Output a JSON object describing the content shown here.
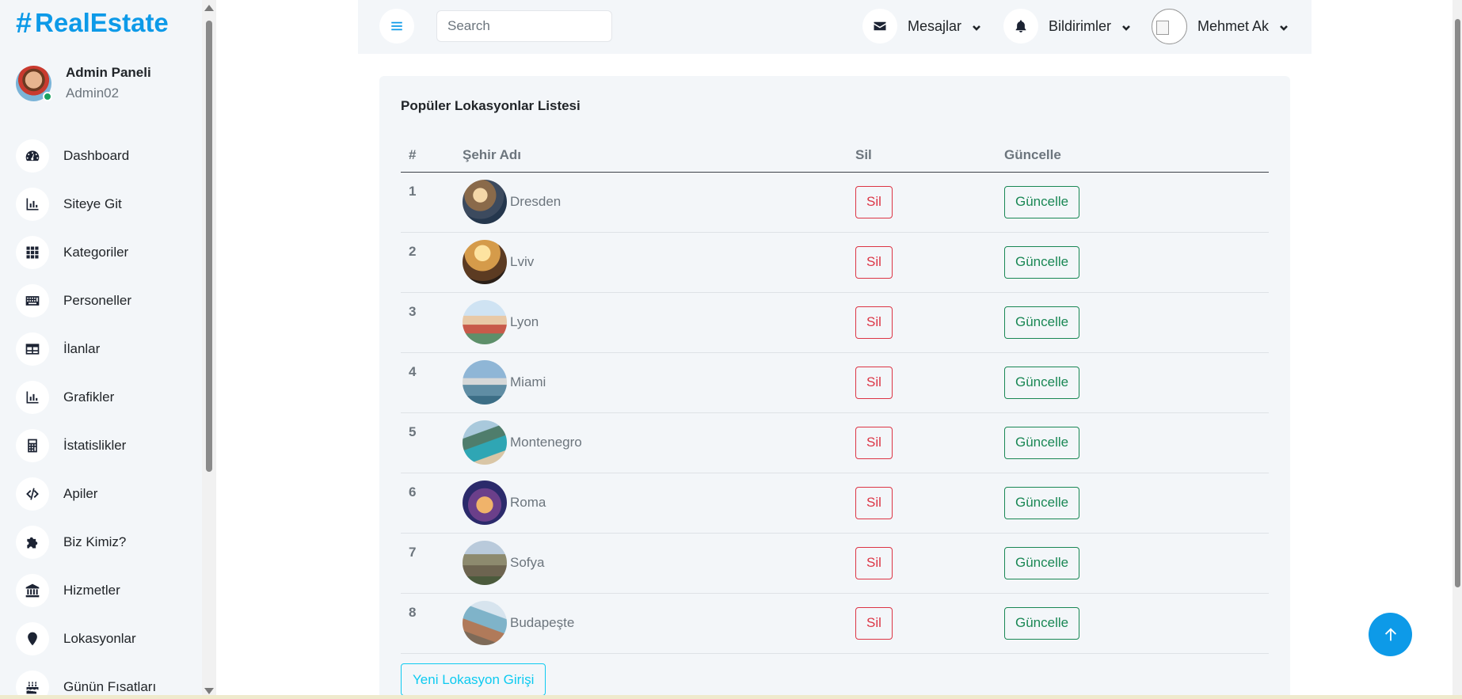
{
  "brand": {
    "hash": "#",
    "name": "RealEstate"
  },
  "profile": {
    "title": "Admin Paneli",
    "role": "Admin02"
  },
  "sidebar": {
    "items": [
      {
        "label": "Dashboard",
        "icon": "tachometer-icon"
      },
      {
        "label": "Siteye Git",
        "icon": "bar-chart-icon"
      },
      {
        "label": "Kategoriler",
        "icon": "grid-icon"
      },
      {
        "label": "Personeller",
        "icon": "keyboard-icon"
      },
      {
        "label": "İlanlar",
        "icon": "table-icon"
      },
      {
        "label": "Grafikler",
        "icon": "bar-chart-icon"
      },
      {
        "label": "İstatislikler",
        "icon": "calculator-icon"
      },
      {
        "label": "Apiler",
        "icon": "code-icon"
      },
      {
        "label": "Biz Kimiz?",
        "icon": "puzzle-icon"
      },
      {
        "label": "Hizmetler",
        "icon": "bank-icon"
      },
      {
        "label": "Lokasyonlar",
        "icon": "map-marker-icon"
      },
      {
        "label": "Günün Fısatları",
        "icon": "birthday-cake-icon"
      }
    ]
  },
  "topbar": {
    "search_placeholder": "Search",
    "messages_label": "Mesajlar",
    "notifications_label": "Bildirimler",
    "user_name": "Mehmet Ak"
  },
  "card": {
    "title": "Popüler Lokasyonlar Listesi",
    "columns": [
      "#",
      "Şehir Adı",
      "Sil",
      "Güncelle"
    ],
    "rows": [
      {
        "num": "1",
        "city": "Dresden",
        "delete": "Sil",
        "update": "Güncelle"
      },
      {
        "num": "2",
        "city": "Lviv",
        "delete": "Sil",
        "update": "Güncelle"
      },
      {
        "num": "3",
        "city": "Lyon",
        "delete": "Sil",
        "update": "Güncelle"
      },
      {
        "num": "4",
        "city": "Miami",
        "delete": "Sil",
        "update": "Güncelle"
      },
      {
        "num": "5",
        "city": "Montenegro",
        "delete": "Sil",
        "update": "Güncelle"
      },
      {
        "num": "6",
        "city": "Roma",
        "delete": "Sil",
        "update": "Güncelle"
      },
      {
        "num": "7",
        "city": "Sofya",
        "delete": "Sil",
        "update": "Güncelle"
      },
      {
        "num": "8",
        "city": "Budapeşte",
        "delete": "Sil",
        "update": "Güncelle"
      }
    ],
    "new_button": "Yeni Lokasyon Girişi"
  },
  "colors": {
    "accent": "#0d9ae8",
    "danger": "#dc3545",
    "success": "#198754",
    "info": "#0dcaf0"
  }
}
